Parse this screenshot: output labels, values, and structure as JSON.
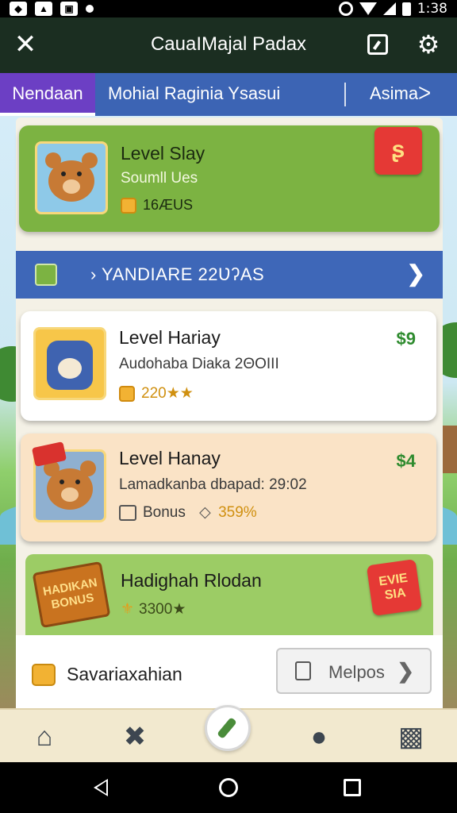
{
  "status_bar": {
    "time": "1:38"
  },
  "header": {
    "title": "CauaIΜajal Padax"
  },
  "tabs": {
    "active": "Nendaan",
    "middle": "Mohial Raginia Ysasui",
    "right": "Asimaᐳ"
  },
  "cards": [
    {
      "title": "Level Slay",
      "subtitle": "Soumll Ues",
      "meta": "16ÆUS",
      "badge": "ʂ"
    },
    {
      "title": "Level Hariay",
      "subtitle": "Audohaba Diaka 2ΘOIII",
      "meta": "220★★",
      "price": "$9"
    },
    {
      "title": "Level Hanay",
      "subtitle": "Lamadkanba dbapad: 29:02",
      "bonus_label": "Bonus",
      "bonus_value": "359%",
      "price": "$4"
    },
    {
      "title": "Hadighah Rlodan",
      "meta": "3300★",
      "sign_text": "HADIKAN BONUS",
      "badge": "EVIE SIA"
    }
  ],
  "section": {
    "title": "› YANDIARE 22ƲʔAS"
  },
  "saver": {
    "label": "Savariaxahian"
  },
  "help": {
    "label": "Melpos"
  },
  "colors": {
    "header_bg": "#1b2e21",
    "tab_bg": "#3c64b4",
    "tab_active": "#6c3fc4",
    "card_green": "#7cb342",
    "section_blue": "#3e67b8",
    "price_green": "#2e8b2e"
  }
}
